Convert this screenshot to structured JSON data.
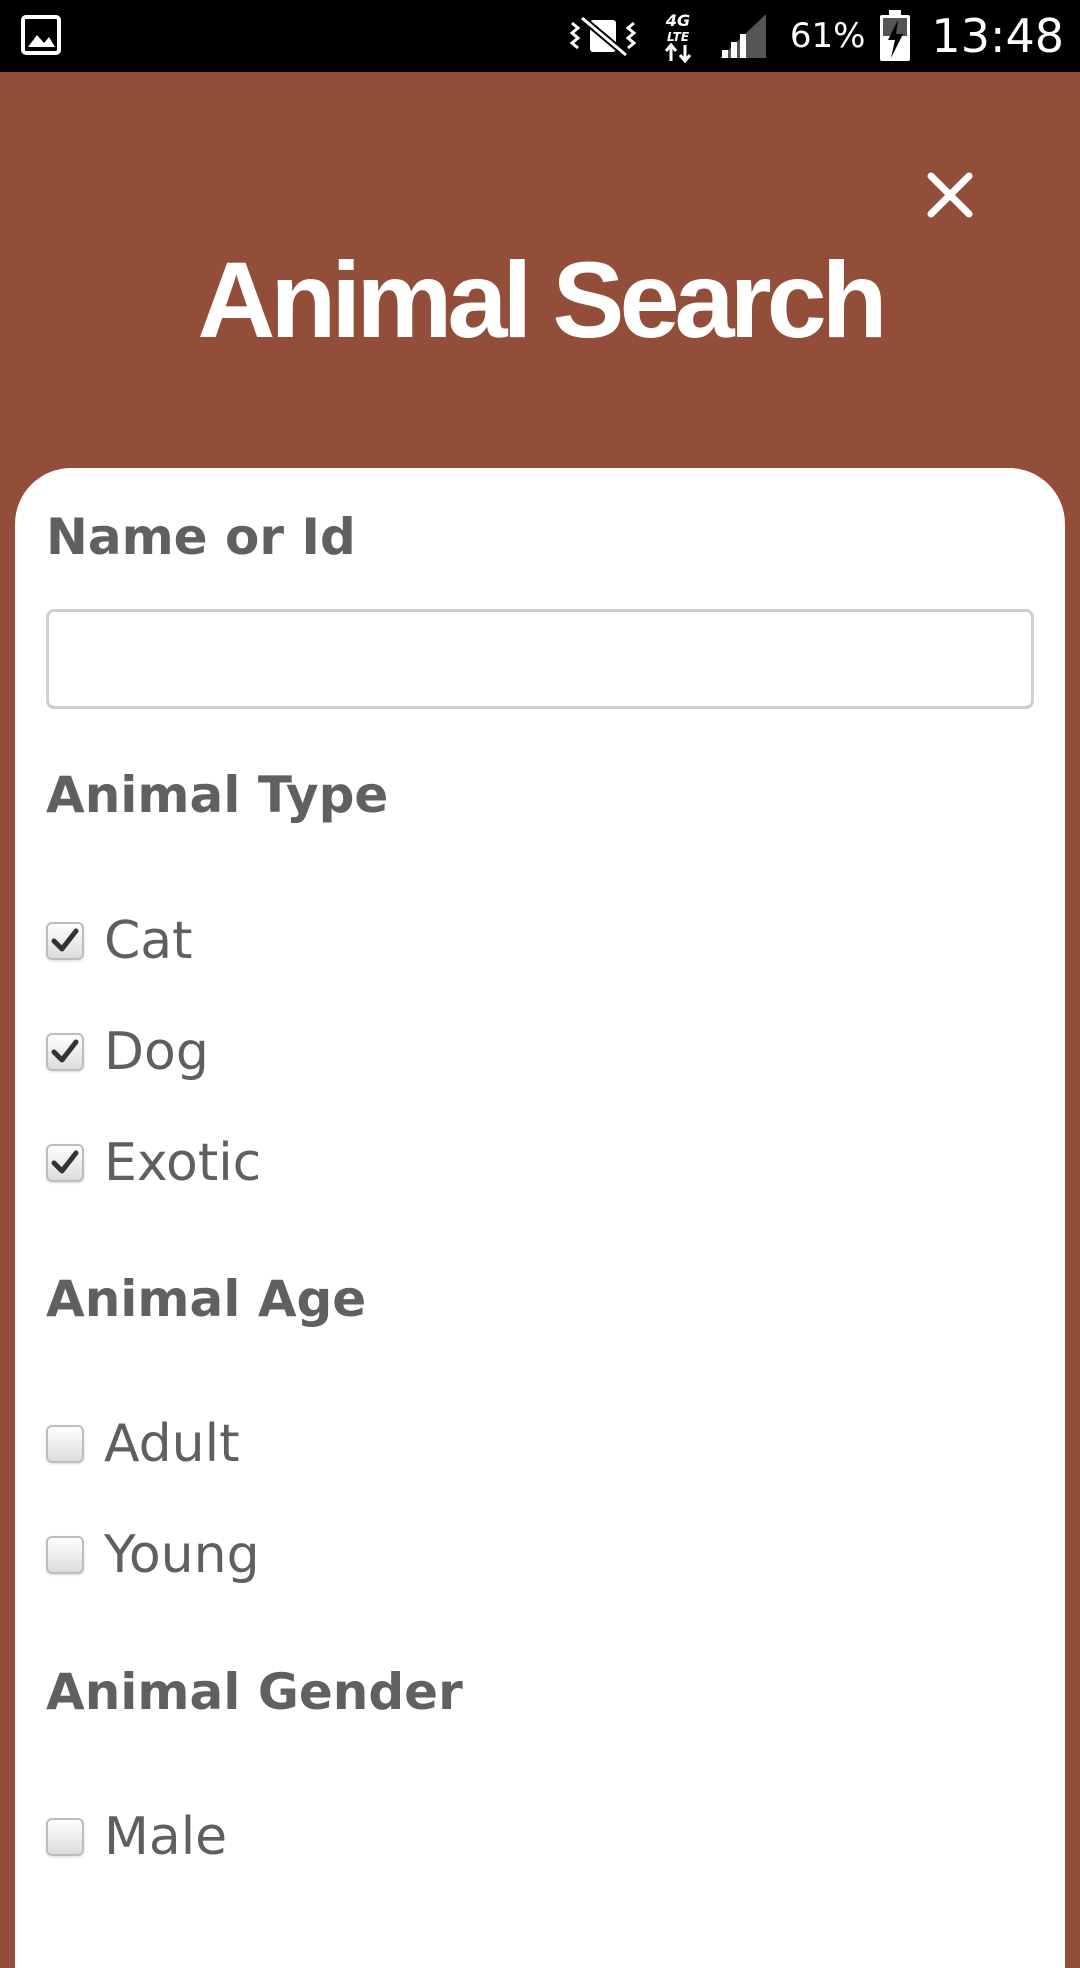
{
  "status_bar": {
    "battery_percent": "61%",
    "time": "13:48",
    "network": "4G LTE"
  },
  "header": {
    "title": "Animal Search",
    "close_icon": "close-icon"
  },
  "form": {
    "name_label": "Name or Id",
    "name_value": "",
    "type_label": "Animal Type",
    "type_options": [
      {
        "label": "Cat",
        "checked": true
      },
      {
        "label": "Dog",
        "checked": true
      },
      {
        "label": "Exotic",
        "checked": true
      }
    ],
    "age_label": "Animal Age",
    "age_options": [
      {
        "label": "Adult",
        "checked": false
      },
      {
        "label": "Young",
        "checked": false
      }
    ],
    "gender_label": "Animal Gender",
    "gender_options": [
      {
        "label": "Male",
        "checked": false
      }
    ]
  },
  "colors": {
    "brand": "#924e38",
    "label_text": "#606060"
  }
}
